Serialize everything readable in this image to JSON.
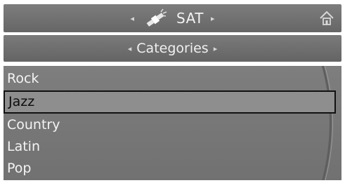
{
  "header": {
    "title": "SAT",
    "source_icon": "satellite-icon",
    "home_icon": "home-icon",
    "left_arrow": "◂",
    "right_arrow": "▸"
  },
  "subheader": {
    "title": "Categories",
    "left_arrow": "◂",
    "right_arrow": "▸"
  },
  "list": {
    "items": [
      "Rock",
      "Jazz",
      "Country",
      "Latin",
      "Pop"
    ],
    "selected_index": 1
  },
  "colors": {
    "bar": "#707070",
    "list_bg": "#7a7a7a",
    "selected_bg": "#8e8e8e",
    "text": "#f2f2f2"
  }
}
